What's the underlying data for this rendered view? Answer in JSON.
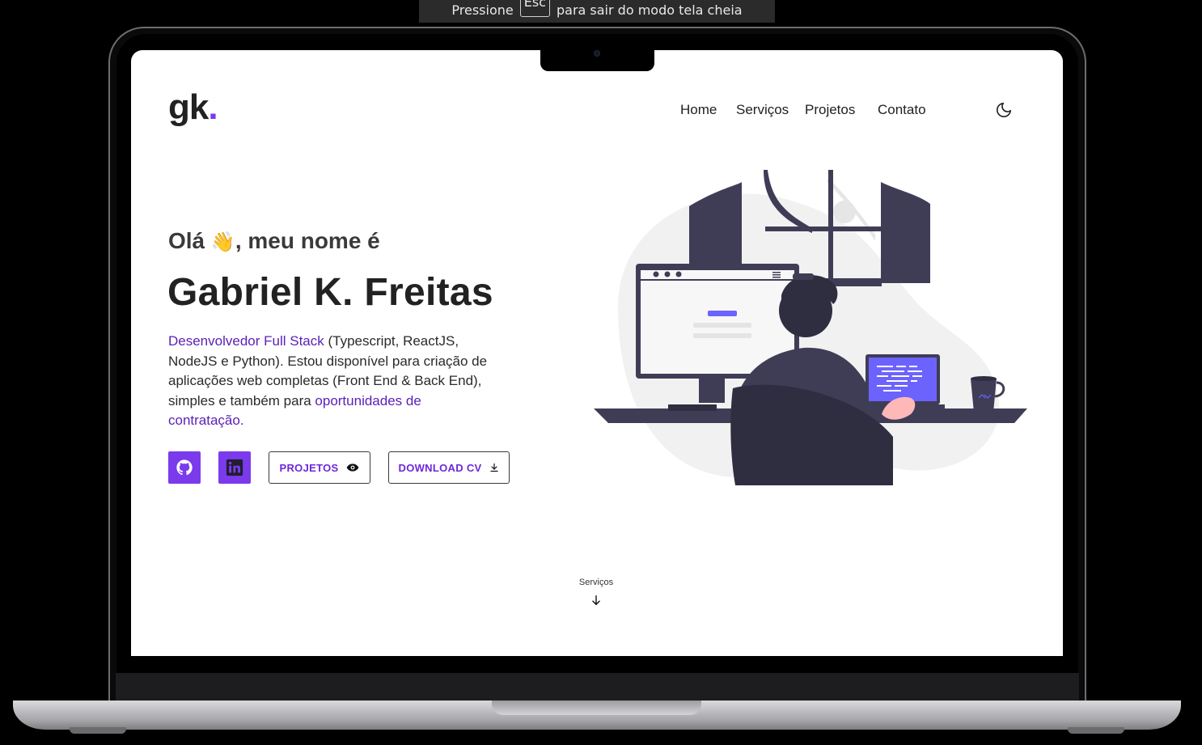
{
  "fullscreen_notice": {
    "before": "Pressione",
    "key": "Esc",
    "after": "para sair do modo tela cheia"
  },
  "header": {
    "logo_text": "gk",
    "logo_dot": ".",
    "nav": [
      {
        "label": "Home"
      },
      {
        "label": "Serviços"
      },
      {
        "label": "Projetos"
      },
      {
        "label": "Contato"
      }
    ],
    "theme_icon": "moon-icon"
  },
  "hero": {
    "greeting_before": "Olá",
    "greeting_emoji": "👋",
    "greeting_after": ", meu nome é",
    "name": "Gabriel K. Freitas",
    "desc_highlight_1": "Desenvolvedor Full Stack",
    "desc_text_1": " (Typescript, ReactJS, NodeJS e Python). Estou disponível para criação de aplicações web completas (Front End &  Back End), simples e também para ",
    "desc_highlight_2": "oportunidades de contratação."
  },
  "actions": {
    "github_icon": "github-icon",
    "linkedin_icon": "linkedin-icon",
    "projects_label": "PROJETOS",
    "projects_icon": "eye-icon",
    "cv_label": "DOWNLOAD CV",
    "cv_icon": "download-icon"
  },
  "scroll_hint": {
    "label": "Serviços",
    "icon": "arrow-down-icon"
  },
  "colors": {
    "accent": "#7c3aed",
    "accent_dark": "#5b21b6",
    "illustration_dark": "#3f3d56",
    "illustration_accent": "#6c63ff"
  }
}
